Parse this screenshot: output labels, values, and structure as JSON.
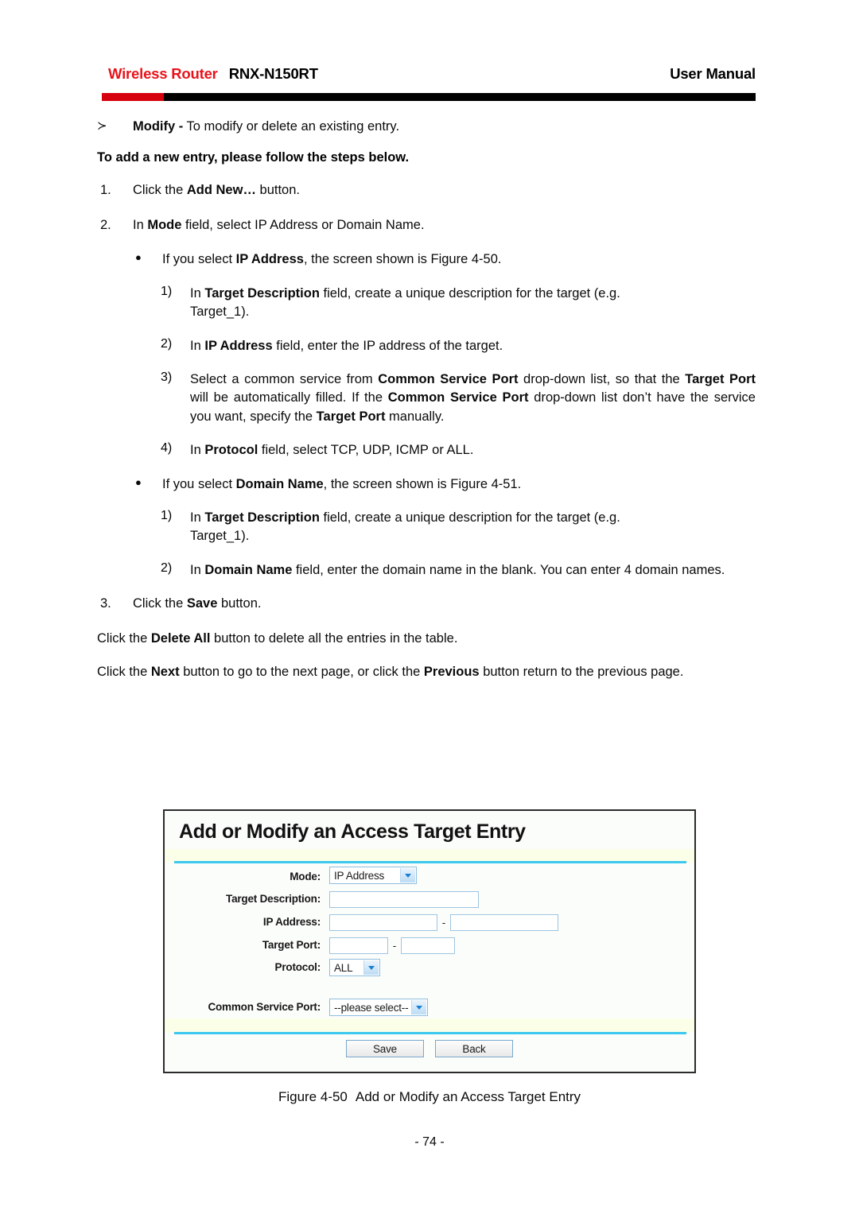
{
  "header": {
    "brand": "Wireless Router",
    "model": "RNX-N150RT",
    "right": "User Manual"
  },
  "body": {
    "modify_marker": "≻",
    "modify_bold": "Modify -",
    "modify_rest": " To modify or delete an existing entry.",
    "steps_heading": "To add a new entry, please follow the steps below.",
    "step1_marker": "1.",
    "step1_a": "Click the ",
    "step1_b": "Add New…",
    "step1_c": " button.",
    "step2_marker": "2.",
    "step2_a": "In ",
    "step2_b": "Mode",
    "step2_c": " field, select IP Address or Domain Name.",
    "bullet_marker": "●",
    "ip_bullet_a": "If you select ",
    "ip_bullet_b": "IP Address",
    "ip_bullet_c": ", the screen shown is Figure 4-50.",
    "n1_marker": "1)",
    "n1_a": "In ",
    "n1_b": "Target Description",
    "n1_c": " field, create a unique description for the target (e.g.",
    "n1_d": "Target_1).",
    "n2_marker": "2)",
    "n2_a": "In ",
    "n2_b": "IP Address",
    "n2_c": " field, enter the IP address of the target.",
    "n3_marker": "3)",
    "n3_a": "Select a common service from ",
    "n3_b": "Common Service Port",
    "n3_c": " drop-down list, so that the ",
    "n3_d": "Target Port",
    "n3_e": " will be automatically filled. If the ",
    "n3_f": "Common Service Port",
    "n3_g": " drop-down list don’t have the service you want, specify the ",
    "n3_h": "Target Port",
    "n3_i": " manually.",
    "n4_marker": "4)",
    "n4_a": "In ",
    "n4_b": "Protocol",
    "n4_c": " field, select TCP, UDP, ICMP or ALL.",
    "dn_bullet_a": "If you select ",
    "dn_bullet_b": "Domain Name",
    "dn_bullet_c": ", the screen shown is Figure 4-51.",
    "d1_marker": "1)",
    "d1_a": "In ",
    "d1_b": "Target Description",
    "d1_c": " field, create a unique description for the target (e.g.",
    "d1_d": "Target_1).",
    "d2_marker": "2)",
    "d2_a": "In ",
    "d2_b": "Domain Name",
    "d2_c": " field, enter the domain name in the blank. You can enter 4 domain names.",
    "step3_marker": "3.",
    "step3_a": "Click the ",
    "step3_b": "Save",
    "step3_c": " button.",
    "deleteall_a": "Click the ",
    "deleteall_b": "Delete All",
    "deleteall_c": " button to delete all the entries in the table.",
    "nav_a": "Click the ",
    "nav_b": "Next",
    "nav_c": " button to go to the next page, or click the ",
    "nav_d": "Previous",
    "nav_e": " button return to the previous page."
  },
  "figure": {
    "panel_title": "Add or Modify an Access Target Entry",
    "fields": {
      "mode_label": "Mode:",
      "mode_value": "IP Address",
      "target_description_label": "Target Description:",
      "target_description_value": "",
      "ip_address_label": "IP Address:",
      "ip_address_start": "",
      "ip_address_end": "",
      "ip_separator": "-",
      "target_port_label": "Target Port:",
      "target_port_start": "",
      "target_port_end": "",
      "port_separator": "-",
      "protocol_label": "Protocol:",
      "protocol_value": "ALL",
      "common_service_port_label": "Common Service Port:",
      "common_service_port_value": "--please select--"
    },
    "buttons": {
      "save": "Save",
      "back": "Back"
    },
    "colors": {
      "cyan_rule": "#3cc8ef",
      "select_border": "#8fbede",
      "input_border": "#9fc4e0",
      "panel_bg": "#fbfdfa",
      "ivory_strip": "#fbffe8"
    }
  },
  "caption": {
    "fignum": "Figure 4-50",
    "text": "Add or Modify an Access Target Entry"
  },
  "footer": {
    "page_number": "- 74 -"
  }
}
